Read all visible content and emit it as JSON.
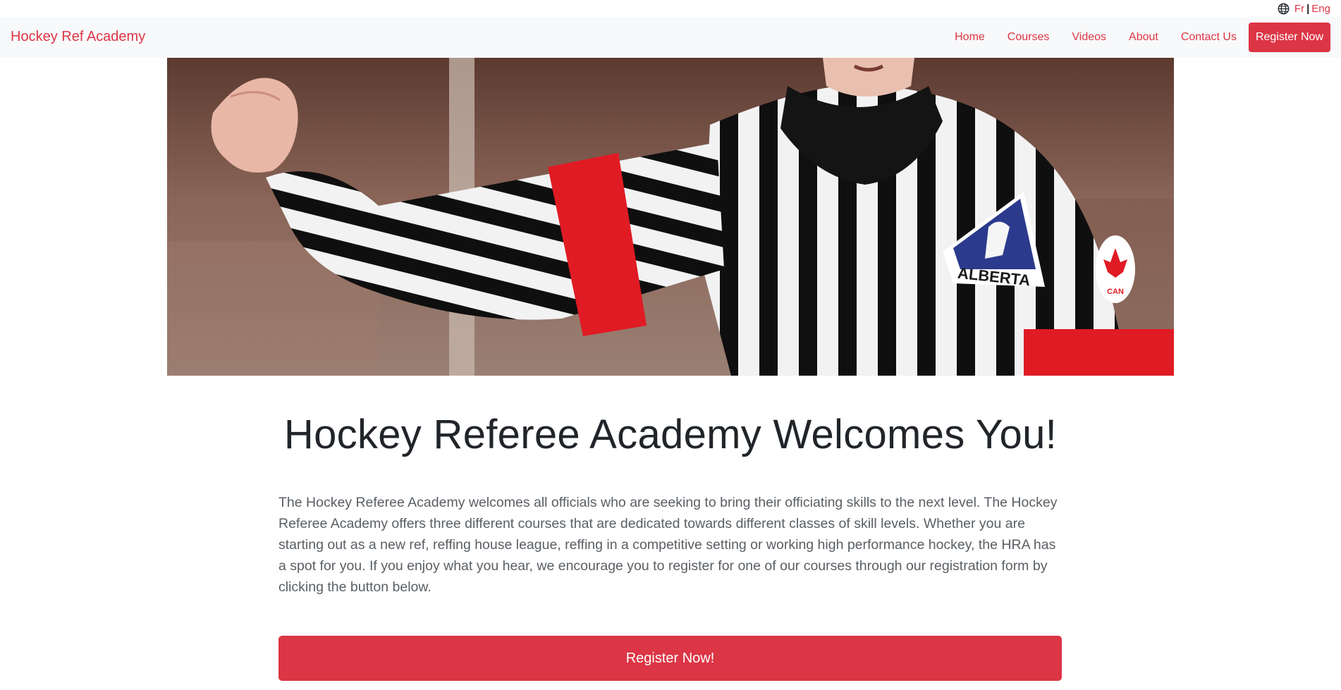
{
  "language": {
    "fr_label": "Fr",
    "separator": "|",
    "eng_label": "Eng",
    "icon": "globe-icon"
  },
  "navbar": {
    "brand": "Hockey Ref Academy",
    "links": [
      "Home",
      "Courses",
      "Videos",
      "About",
      "Contact Us"
    ],
    "register_label": "Register Now"
  },
  "hero": {
    "patch_text": "ALBERTA",
    "flag_text": "CAN"
  },
  "main": {
    "title": "Hockey Referee Academy Welcomes You!",
    "intro": "The Hockey Referee Academy welcomes all officials who are seeking to bring their officiating skills to the next level. The Hockey Referee Academy offers three different courses that are dedicated towards different classes of skill levels. Whether you are starting out as a new ref, reffing house league, reffing in a competitive setting or working high performance hockey, the HRA has a spot for you. If you enjoy what you hear, we encourage you to register for one of our courses through our registration form by clicking the button below.",
    "cta_label": "Register Now!"
  },
  "colors": {
    "accent": "#dc3545",
    "navbar_bg": "#f8f9fa",
    "text": "#212529"
  }
}
